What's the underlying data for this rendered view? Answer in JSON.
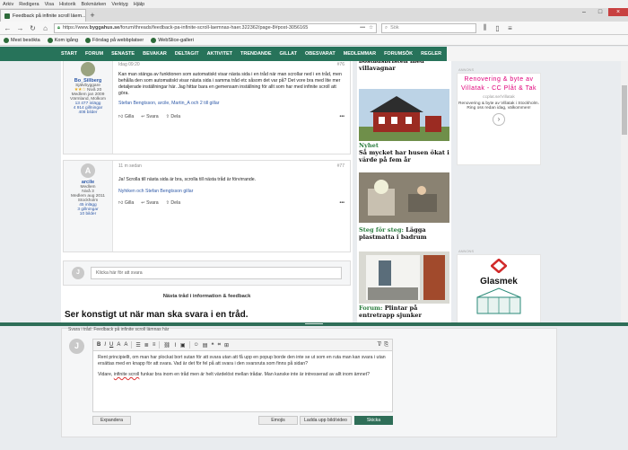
{
  "menus": [
    "Arkiv",
    "Redigera",
    "Visa",
    "Historik",
    "Bokmärken",
    "Verktyg",
    "Hjälp"
  ],
  "tab": {
    "title": "Feedback på infinite scroll läem..."
  },
  "url": {
    "prefix": "https://www.",
    "domain": "byggahus.se",
    "path": "/forum/threads/feedback-pa-infinite-scroll-laemnas-haer.322362/page-8#post-3056165"
  },
  "search": {
    "placeholder": "Sök"
  },
  "bookmarks": [
    "Mest besökta",
    "Kom igång",
    "Förslag på webbplatser",
    "WebSlice-galleri"
  ],
  "sitenav": [
    "START",
    "FORUM",
    "SENASTE",
    "BEVAKAR",
    "DELTAGIT",
    "AKTIVITET",
    "TRENDANDE",
    "GILLAT",
    "OBESVARAT",
    "MEDLEMMAR",
    "FORUMSÖK",
    "REGLER"
  ],
  "post1": {
    "user": "Bo_Sillberg",
    "role": "Självbyggare",
    "stars": "★★☆",
    "level": "Nivå 20",
    "member": "Medlem jan 2009",
    "location": "Värmland, Molkom",
    "posts": "13 477 inlägg",
    "likes": "4 914 gillningar",
    "images": "408 bilder",
    "time": "Idag 09:20",
    "no": "#76",
    "text": "Kan man stänga av funktionen som automatiskt visar nästa sida i en tråd när man scrollar ned i en tråd, men behålla den som automatiskt visar nästa sida i samma tråd etc såsom det var på? Det vore bra med lite mer detaljerade inställningar här. Jag hittar bara en gemensam inställning för allt som har med infinite scroll att göra.",
    "likers": "Stefan Bengtsson, arcile, Martin_A och 2 till gillar"
  },
  "post2": {
    "initial": "A",
    "user": "arcile",
    "role": "Medlem",
    "level": "Nivå 3",
    "member": "Medlem aug 2011",
    "location": "Stockholm",
    "posts": "45 inlägg",
    "likes": "3 gillningar",
    "images": "10 bilder",
    "time": "11 m sedan",
    "no": "#77",
    "text": "Ja! Scrolla till nästa sida är bra, scrolla till nästa tråd är förvirrande.",
    "likers": "Nyhiken och Stefan Bengtsson gillar"
  },
  "actions": {
    "like": "Gilla",
    "reply": "Svara",
    "share": "Dela",
    "more": "•••"
  },
  "quickreply": {
    "initial": "J",
    "placeholder": "Klicka här för att svara"
  },
  "next": {
    "heading": "Nästa tråd i information & feedback",
    "title": "Ser konstigt ut när man ska svara i en tråd."
  },
  "news": [
    {
      "headline": "bostadsbristen med villavagnar"
    },
    {
      "tag": "Nyhet",
      "headline": "Så mycket har husen ökat i värde på fem år"
    },
    {
      "tag": "Steg för steg:",
      "headline": "Lägga plastmatta i badrum"
    },
    {
      "tag": "Forum:",
      "headline": "Plintar på entretrapp sjunker"
    }
  ],
  "ads": {
    "label": "ANNONS",
    "ad1": {
      "title": "Renovering & bytе av Villatak - CC Plåt & Tak",
      "site": "ccplat.se/Villatak",
      "desc": "Renovering & byte av Villatak i Stockholm. Ring oss redan idag, välkommen!"
    },
    "ad2": {
      "brand": "Glasmek"
    }
  },
  "editor": {
    "title": "Svara i tråd: Feedback på infinite scroll lämnas här",
    "initial": "J",
    "p1": "Rent principiellt, om man har plockat bort sutan för att svara utan att få upp en popup borde den inte se ut som en ruta man kan svara i utan ersättas med en knapp för att svara. Vad är det för fel på att svara i den svarsruta som finns på sidan?",
    "p2a": "Vidare, ",
    "p2b": "infinite scroll",
    "p2c": " funkar bra inom en tråd men är helt värdelöst mellan trådar. Man kanske inte är intresserad av allt inom ämnet?",
    "expand": "Expandera",
    "emoji": "Emojis",
    "upload": "Ladda upp bild/video",
    "send": "Skicka"
  },
  "colors": {
    "green": "#27735a",
    "pink": "#e0007a"
  }
}
